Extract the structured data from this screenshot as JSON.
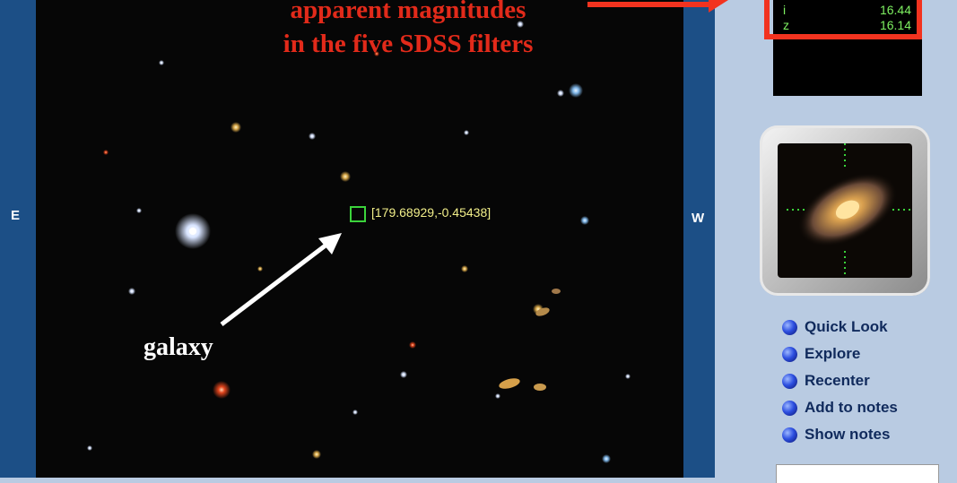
{
  "compass": {
    "east": "E",
    "west": "W"
  },
  "annotation": {
    "line1": "apparent magnitudes",
    "line2": "in the five SDSS filters",
    "galaxy_label": "galaxy",
    "color": "#e22a1a"
  },
  "sky": {
    "coordinate_label": "[179.68929,-0.45438]"
  },
  "magnitudes": [
    {
      "band": "i",
      "value": "16.44"
    },
    {
      "band": "z",
      "value": "16.14"
    }
  ],
  "nav_items": [
    {
      "label": "Quick Look",
      "icon": "bullet-icon"
    },
    {
      "label": "Explore",
      "icon": "bullet-icon"
    },
    {
      "label": "Recenter",
      "icon": "bullet-icon"
    },
    {
      "label": "Add to notes",
      "icon": "bullet-icon"
    },
    {
      "label": "Show notes",
      "icon": "bullet-icon"
    }
  ],
  "colors": {
    "frame_blue": "#1c4f86",
    "panel_bg": "#b9cbe2",
    "mag_text": "#7ef061",
    "highlight_red": "#f2331f"
  }
}
